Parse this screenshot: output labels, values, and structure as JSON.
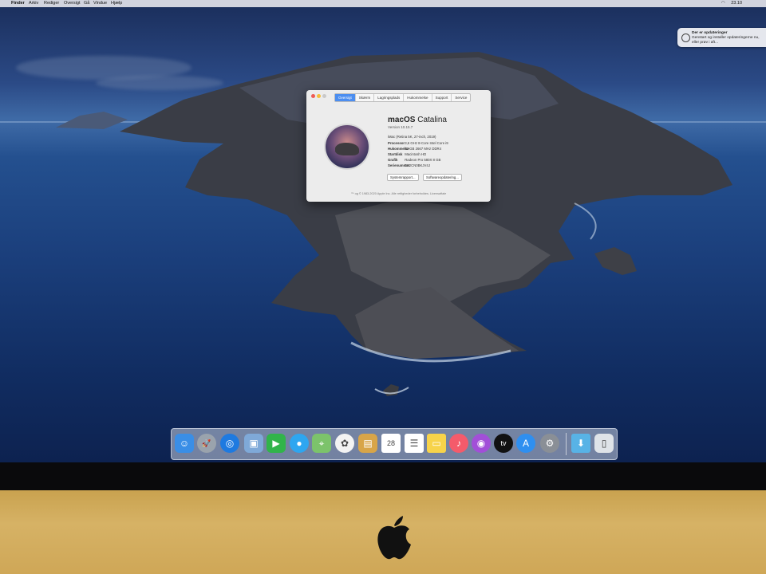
{
  "menubar": {
    "items": [
      "Finder",
      "Arkiv",
      "Rediger",
      "Oversigt",
      "Gå",
      "Vindue",
      "Hjælp"
    ],
    "clock": "23.10"
  },
  "notification": {
    "title": "Der er opdateringer",
    "body": "Genstart og installer opdateringerne nu, eller prøv i aft..."
  },
  "about_window": {
    "tabs": [
      "Oversigt",
      "Skærm",
      "Lagringsplads",
      "Hukommelse",
      "Support",
      "Service"
    ],
    "active_tab": "Oversigt",
    "os_name_bold": "macOS",
    "os_name_light": "Catalina",
    "version": "Version 10.15.7",
    "specs": [
      {
        "k": "",
        "v": "iMac (Retina 5K, 27-inch, 2019)"
      },
      {
        "k": "Processor",
        "v": "3,6 GHz 8-Core Intel Core i9"
      },
      {
        "k": "Hukommelse",
        "v": "32 GB 2667 MHz DDR4"
      },
      {
        "k": "Startdisk",
        "v": "Macintosh HD"
      },
      {
        "k": "Grafik",
        "v": "Radeon Pro 580X 8 GB"
      },
      {
        "k": "Serienummer",
        "v": "C02CN0BKJV4J"
      }
    ],
    "buttons": [
      "Systemrapport...",
      "Softwareopdatering..."
    ],
    "copyright": "™ og © 1983-2020 Apple Inc. Alle rettigheder forbeholdes. Licensaftale"
  },
  "dock": {
    "apps": [
      {
        "name": "finder-icon",
        "bg": "#3a8ee6",
        "glyph": "☺"
      },
      {
        "name": "launchpad-icon",
        "bg": "#9aa3ad",
        "glyph": "🚀"
      },
      {
        "name": "safari-icon",
        "bg": "#1e7ae0",
        "glyph": "◎"
      },
      {
        "name": "preview-icon",
        "bg": "#7fa9d8",
        "glyph": "▣"
      },
      {
        "name": "facetime-icon",
        "bg": "#31b44a",
        "glyph": "▶"
      },
      {
        "name": "messages-icon",
        "bg": "#2ea6f0",
        "glyph": "●"
      },
      {
        "name": "maps-icon",
        "bg": "#7cc36b",
        "glyph": "⌖"
      },
      {
        "name": "photos-icon",
        "bg": "#f3f3f3",
        "glyph": "✿"
      },
      {
        "name": "contacts-icon",
        "bg": "#d8a548",
        "glyph": "▤"
      },
      {
        "name": "calendar-icon",
        "bg": "#ffffff",
        "glyph": "28"
      },
      {
        "name": "reminders-icon",
        "bg": "#ffffff",
        "glyph": "☰"
      },
      {
        "name": "notes-icon",
        "bg": "#f7d34a",
        "glyph": "▭"
      },
      {
        "name": "music-icon",
        "bg": "#f45b6b",
        "glyph": "♪"
      },
      {
        "name": "podcasts-icon",
        "bg": "#a24fd8",
        "glyph": "◉"
      },
      {
        "name": "tv-icon",
        "bg": "#111111",
        "glyph": "tv"
      },
      {
        "name": "app-store-icon",
        "bg": "#2f8ff0",
        "glyph": "A"
      },
      {
        "name": "system-preferences-icon",
        "bg": "#8a8f96",
        "glyph": "⚙"
      },
      {
        "name": "downloads-folder-icon",
        "bg": "#58b3e6",
        "glyph": "⬇"
      },
      {
        "name": "trash-icon",
        "bg": "#dfe3e8",
        "glyph": "▯"
      }
    ]
  }
}
